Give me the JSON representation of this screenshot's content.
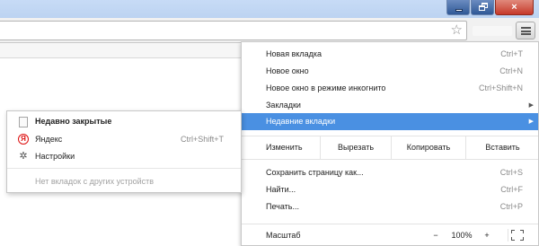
{
  "window": {
    "minimize_label": "",
    "restore_label": "",
    "close_label": "×"
  },
  "toolbar": {
    "star_icon": "☆"
  },
  "menu": {
    "items_top": [
      {
        "label": "Новая вкладка",
        "shortcut": "Ctrl+T"
      },
      {
        "label": "Новое окно",
        "shortcut": "Ctrl+N"
      },
      {
        "label": "Новое окно в режиме инкогнито",
        "shortcut": "Ctrl+Shift+N"
      },
      {
        "label": "Закладки",
        "shortcut": ""
      },
      {
        "label": "Недавние вкладки",
        "shortcut": ""
      }
    ],
    "edit": {
      "label": "Изменить",
      "cut": "Вырезать",
      "copy": "Копировать",
      "paste": "Вставить"
    },
    "items_mid": [
      {
        "label": "Сохранить страницу как...",
        "shortcut": "Ctrl+S"
      },
      {
        "label": "Найти...",
        "shortcut": "Ctrl+F"
      },
      {
        "label": "Печать...",
        "shortcut": "Ctrl+P"
      }
    ],
    "zoom": {
      "label": "Масштаб",
      "minus": "−",
      "value": "100%",
      "plus": "+"
    }
  },
  "submenu": {
    "heading": "Недавно закрытые",
    "items": [
      {
        "label": "Яндекс",
        "shortcut": "Ctrl+Shift+T",
        "icon": "yandex-icon"
      },
      {
        "label": "Настройки",
        "shortcut": "",
        "icon": "gear-icon"
      }
    ],
    "no_devices": "Нет вкладок с других устройств"
  }
}
